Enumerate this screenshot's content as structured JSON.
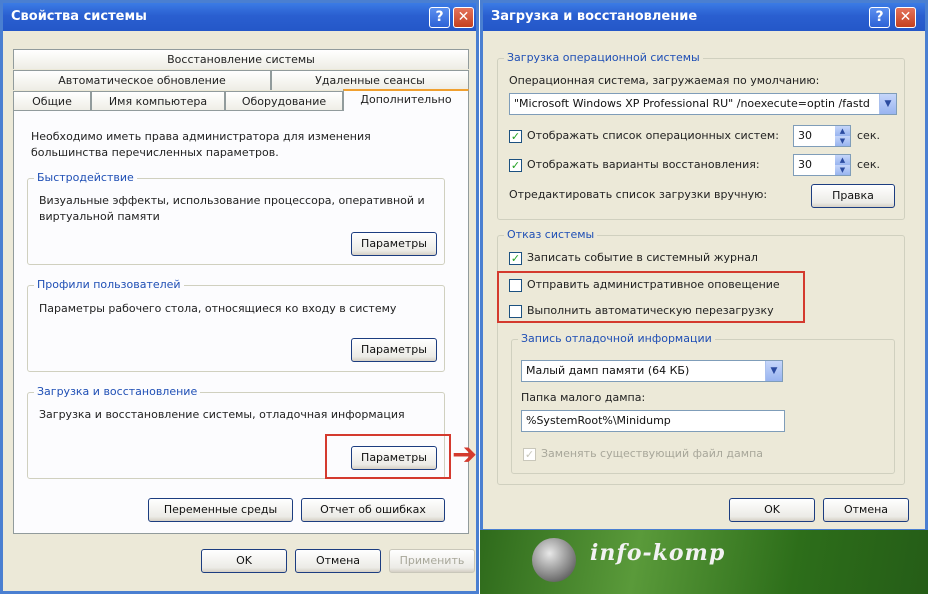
{
  "left_window": {
    "title": "Свойства системы",
    "help_glyph": "?",
    "close_glyph": "✕",
    "tabs_row1": [
      "Восстановление системы"
    ],
    "tabs_row2": [
      "Автоматическое обновление",
      "Удаленные сеансы"
    ],
    "tabs_row3": [
      "Общие",
      "Имя компьютера",
      "Оборудование",
      "Дополнительно"
    ],
    "active_tab": "Дополнительно",
    "intro_text": "Необходимо иметь права администратора для изменения большинства перечисленных параметров.",
    "groups": [
      {
        "title": "Быстродействие",
        "text": "Визуальные эффекты, использование процессора, оперативной и виртуальной памяти",
        "button": "Параметры"
      },
      {
        "title": "Профили пользователей",
        "text": "Параметры рабочего стола, относящиеся ко входу в систему",
        "button": "Параметры"
      },
      {
        "title": "Загрузка и восстановление",
        "text": "Загрузка и восстановление системы, отладочная информация",
        "button": "Параметры"
      }
    ],
    "env_button": "Переменные среды",
    "error_button": "Отчет об ошибках",
    "ok_button": "OK",
    "cancel_button": "Отмена",
    "apply_button": "Применить"
  },
  "right_window": {
    "title": "Загрузка и восстановление",
    "help_glyph": "?",
    "close_glyph": "✕",
    "os_group_title": "Загрузка операционной системы",
    "default_os_label": "Операционная система, загружаемая по умолчанию:",
    "default_os_value": "\"Microsoft Windows XP Professional RU\" /noexecute=optin /fastd",
    "show_os_list_label": "Отображать список операционных систем:",
    "show_os_list_checked": true,
    "show_os_list_seconds": "30",
    "show_recovery_label": "Отображать варианты восстановления:",
    "show_recovery_checked": true,
    "show_recovery_seconds": "30",
    "seconds_unit": "сек.",
    "edit_boot_label": "Отредактировать список загрузки вручную:",
    "edit_button": "Правка",
    "failure_group_title": "Отказ системы",
    "write_event_label": "Записать событие в системный журнал",
    "write_event_checked": true,
    "send_alert_label": "Отправить административное оповещение",
    "send_alert_checked": false,
    "auto_restart_label": "Выполнить автоматическую перезагрузку",
    "auto_restart_checked": false,
    "debug_group_title": "Запись отладочной информации",
    "dump_type_value": "Малый дамп памяти (64 КБ)",
    "dump_folder_label": "Папка малого дампа:",
    "dump_folder_value": "%SystemRoot%\\Minidump",
    "overwrite_label": "Заменять существующий файл дампа",
    "overwrite_checked": true,
    "ok_button": "OK",
    "cancel_button": "Отмена"
  },
  "arrow_glyph": "➔",
  "watermark_text": "info-komp",
  "colors": {
    "highlight": "#d43a2e",
    "titlebar": "#2a5fd0",
    "group_title": "#1f4fb5",
    "banner": "#3c7d24"
  }
}
